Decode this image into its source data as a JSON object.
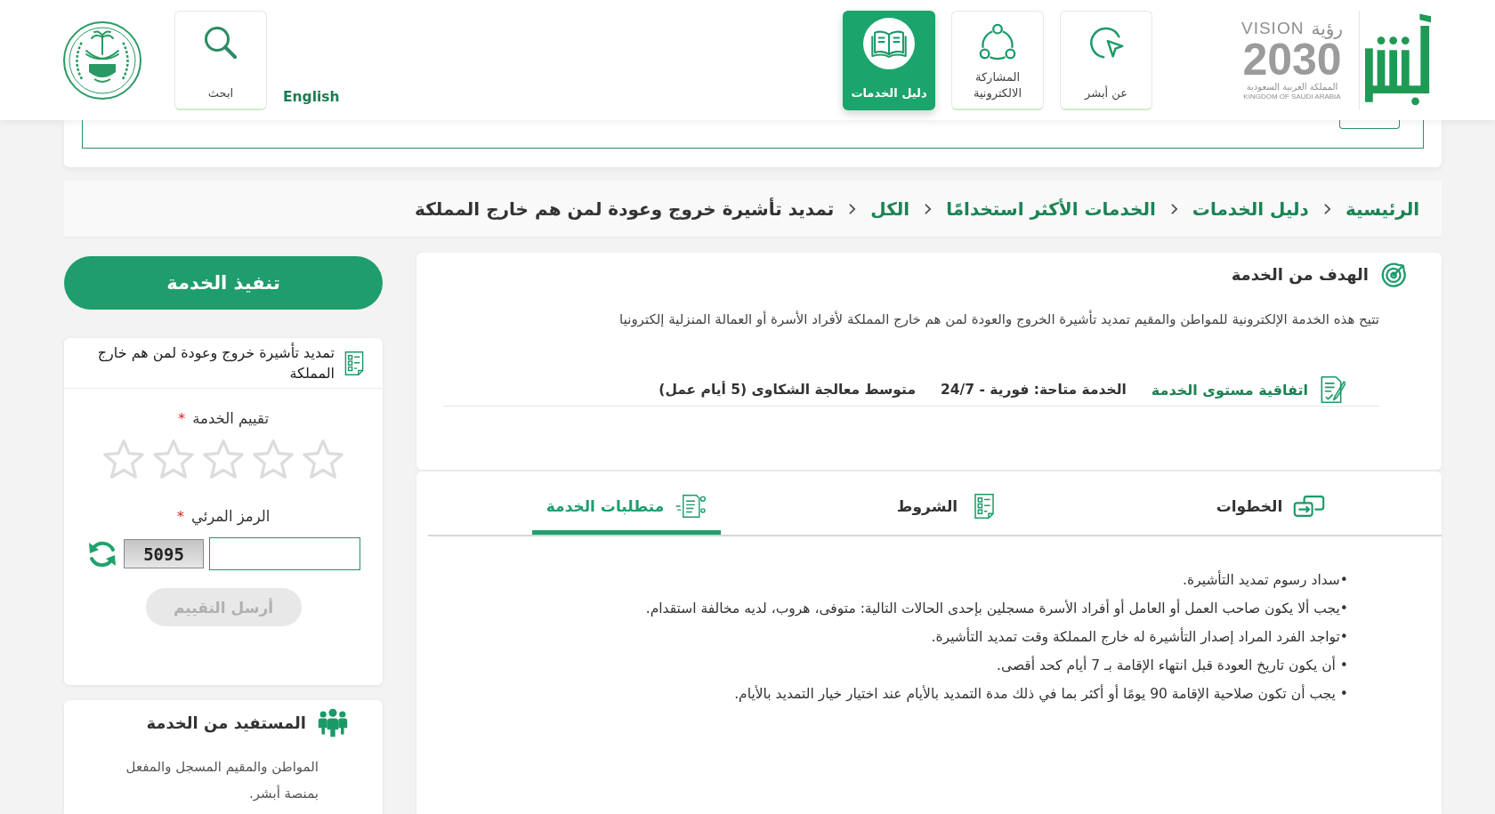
{
  "header": {
    "vision_logo": {
      "wordmark_ar": "رؤية",
      "wordmark_en": "VISION",
      "year": "2030",
      "country_ar": "المملكة العربية السعودية",
      "country_en": "KINGDOM OF SAUDI ARABIA"
    },
    "nav": [
      {
        "label": "عن أبشر",
        "selected": false
      },
      {
        "label": "المشاركة الالكترونية",
        "selected": false
      },
      {
        "label": "دليل الخدمات",
        "selected": true
      }
    ],
    "language_link": "English",
    "search": {
      "label": "ابحث"
    }
  },
  "breadcrumb": [
    {
      "label": "الرئيسية",
      "current": false
    },
    {
      "label": "دليل الخدمات",
      "current": false
    },
    {
      "label": "الخدمات الأكثر استخدامًا",
      "current": false
    },
    {
      "label": "الكل",
      "current": false
    },
    {
      "label": "تمديد تأشيرة خروج وعودة لمن هم خارج المملكة",
      "current": true
    }
  ],
  "goal": {
    "title": "الهدف من الخدمة",
    "description": "تتيح هذه الخدمة الإلكترونية للمواطن والمقيم تمديد تأشيرة الخروج والعودة لمن هم خارج المملكة لأفراد الأسرة أو العمالة المنزلية إلكترونيا",
    "sla_link": "اتفاقية مستوى الخدمة",
    "availability": "الخدمة متاحة: فورية - 24/7",
    "complaints": "متوسط معالجة الشكاوى (5 أيام عمل)"
  },
  "tabs": [
    {
      "label": "الخطوات",
      "selected": false
    },
    {
      "label": "الشروط",
      "selected": false
    },
    {
      "label": "متطلبات الخدمة",
      "selected": true
    }
  ],
  "requirements": [
    "•سداد رسوم تمديد التأشيرة.",
    "•يجب ألا يكون صاحب العمل أو العامل أو أفراد الأسرة مسجلين بإحدى الحالات التالية: متوفى، هروب، لديه مخالفة استقدام.",
    "•تواجد الفرد المراد إصدار التأشيرة له خارج المملكة وقت تمديد التأشيرة.",
    "• أن يكون تاريخ العودة قبل انتهاء الإقامة بـ 7 أيام كحد أقصى.",
    "• يجب أن تكون صلاحية الإقامة 90 يومًا أو أكثر بما في ذلك مدة التمديد بالأيام عند اختيار خيار التمديد بالأيام."
  ],
  "execute_button": "تنفيذ الخدمة",
  "service_card": {
    "title": "تمديد تأشيرة خروج وعودة لمن هم خارج المملكة",
    "rating": {
      "label": "تقييم الخدمة",
      "required_mark": "*",
      "stars": 0
    },
    "captcha": {
      "label": "الرمز المرئي",
      "required_mark": "*",
      "code": "5095"
    },
    "submit": {
      "label": "أرسل التقييم",
      "disabled": true
    }
  },
  "beneficiary": {
    "title": "المستفيد من الخدمة",
    "text": "المواطن والمقيم المسجل والمفعل بمنصة أبشر."
  }
}
